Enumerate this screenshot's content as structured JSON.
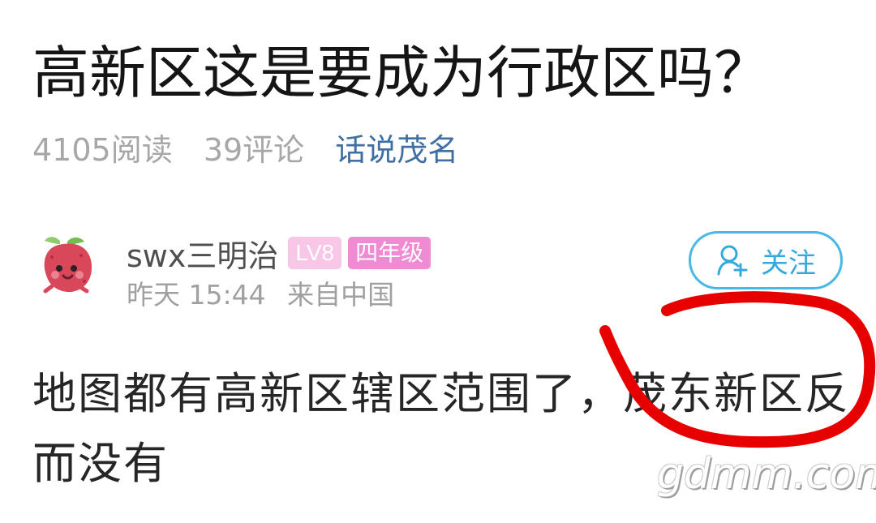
{
  "article": {
    "title": "高新区这是要成为行政区吗？",
    "reads": "4105阅读",
    "comments": "39评论",
    "topic": "话说茂名"
  },
  "author": {
    "name": "swx三明治",
    "level_badge": "LV8",
    "grade_badge": "四年级",
    "time": "昨天 15:44",
    "location": "来自中国",
    "follow_label": "关注"
  },
  "post": {
    "content": "地图都有高新区辖区范围了，茂东新区反而没有"
  },
  "watermark": {
    "text": "gdmm.com"
  },
  "colors": {
    "topic": "#3f6fa3",
    "follow": "#35a8de",
    "level_badge": "#f8c7e7",
    "grade_badge": "#ee8bd2",
    "annotation": "#e70000"
  },
  "icons": {
    "avatar": "lychee-avatar",
    "follow": "add-user-icon"
  }
}
